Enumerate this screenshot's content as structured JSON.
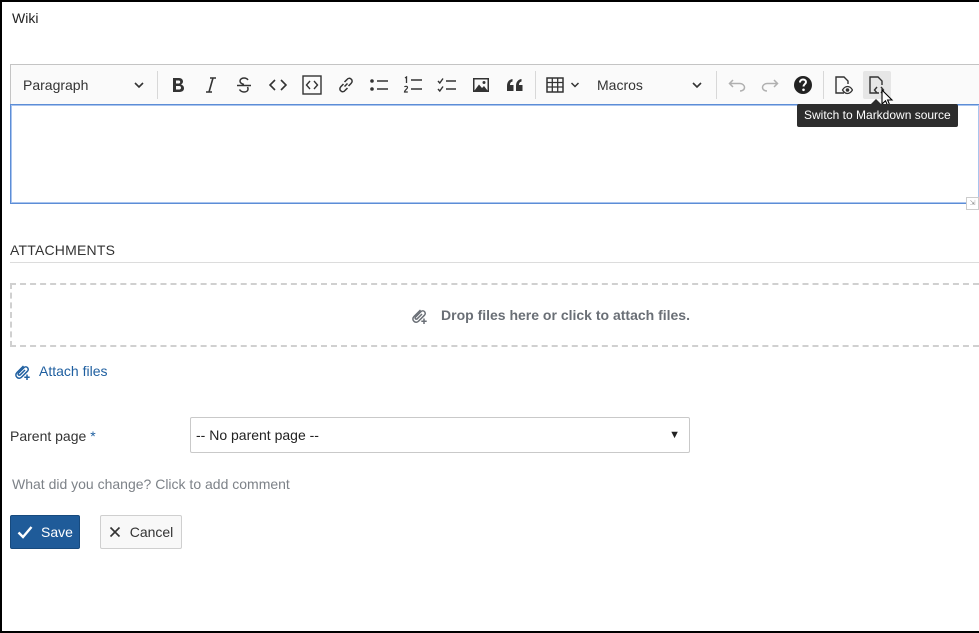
{
  "page": {
    "title": "Wiki"
  },
  "toolbar": {
    "paragraph_label": "Paragraph",
    "macros_label": "Macros",
    "tooltip": "Switch to Markdown source",
    "buttons": [
      "bold-icon",
      "italic-icon",
      "strikethrough-icon",
      "code-icon",
      "code-block-icon",
      "link-icon",
      "bulleted-list-icon",
      "numbered-list-icon",
      "todo-list-icon",
      "image-icon",
      "blockquote-icon",
      "table-icon",
      "undo-icon",
      "redo-icon",
      "help-icon",
      "preview-icon",
      "markdown-source-icon"
    ]
  },
  "attachments": {
    "heading": "ATTACHMENTS",
    "dropzone_text": "Drop files here or click to attach files.",
    "attach_link": "Attach files"
  },
  "form": {
    "parent_label": "Parent page",
    "required_mark": "*",
    "parent_value": "-- No parent page --",
    "comment_placeholder": "What did you change? Click to add comment"
  },
  "actions": {
    "save": "Save",
    "cancel": "Cancel"
  }
}
